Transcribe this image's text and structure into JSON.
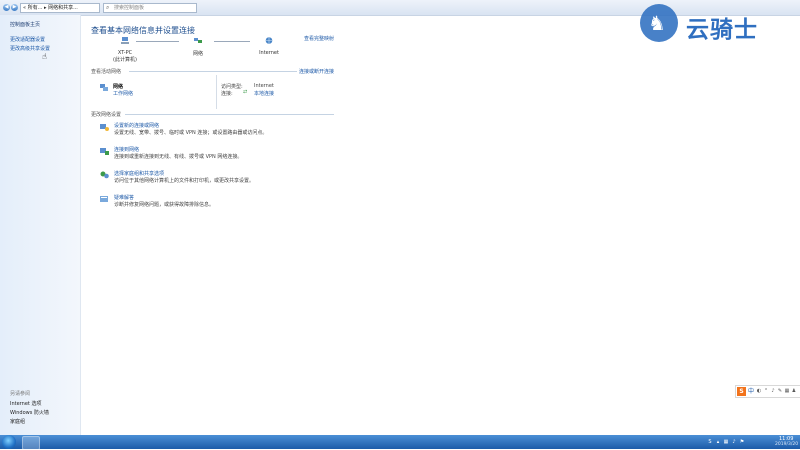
{
  "address_bar": {
    "back_glyph": "◀",
    "forward_glyph": "▶",
    "breadcrumb": "« 所有... ▸ 网络和共享...",
    "search_placeholder": "搜索控制面板"
  },
  "sidebar": {
    "home": "控制面板主页",
    "links": [
      "更改适配器设置",
      "更改高级共享设置"
    ],
    "see_also_heading": "另请参阅",
    "see_also": [
      "Internet 选项",
      "Windows 防火墙",
      "家庭组"
    ]
  },
  "main": {
    "title": "查看基本网络信息并设置连接",
    "see_full_map": "查看完整映射",
    "map_nodes": [
      {
        "label": "XT-PC",
        "sublabel": "(此计算机)"
      },
      {
        "label": "网络",
        "sublabel": ""
      },
      {
        "label": "Internet",
        "sublabel": ""
      }
    ],
    "active_networks_heading": "查看活动网络",
    "connect_disconnect": "连接或断开连接",
    "network": {
      "name": "网络",
      "type": "工作网络"
    },
    "access": {
      "access_type_label": "访问类型:",
      "access_type_value": "Internet",
      "connection_label": "连接:",
      "connection_value": "本地连接"
    },
    "change_settings_heading": "更改网络设置",
    "tasks": [
      {
        "title": "设置新的连接或网络",
        "desc": "设置无线、宽带、拨号、临时或 VPN 连接；或设置路由器或访问点。"
      },
      {
        "title": "连接到网络",
        "desc": "连接到或重新连接到无线、有线、拨号或 VPN 网络连接。"
      },
      {
        "title": "选择家庭组和共享选项",
        "desc": "访问位于其他网络计算机上的文件和打印机，或更改共享设置。"
      },
      {
        "title": "疑难解答",
        "desc": "诊断并修复网络问题，或获得故障排除信息。"
      }
    ]
  },
  "watermark": {
    "text": "云骑士",
    "glyph": "♞"
  },
  "ime_bar": {
    "logo": "S",
    "mode": "中",
    "icons": [
      "◐",
      "°",
      "♪",
      "✎",
      "▦",
      "♟",
      "⚙"
    ]
  },
  "clock": {
    "time": "11:09",
    "date": "2019/3/20"
  },
  "colors": {
    "link": "#1e5aa8",
    "title": "#1f4f8f",
    "taskbar": "#2a6cc0"
  }
}
